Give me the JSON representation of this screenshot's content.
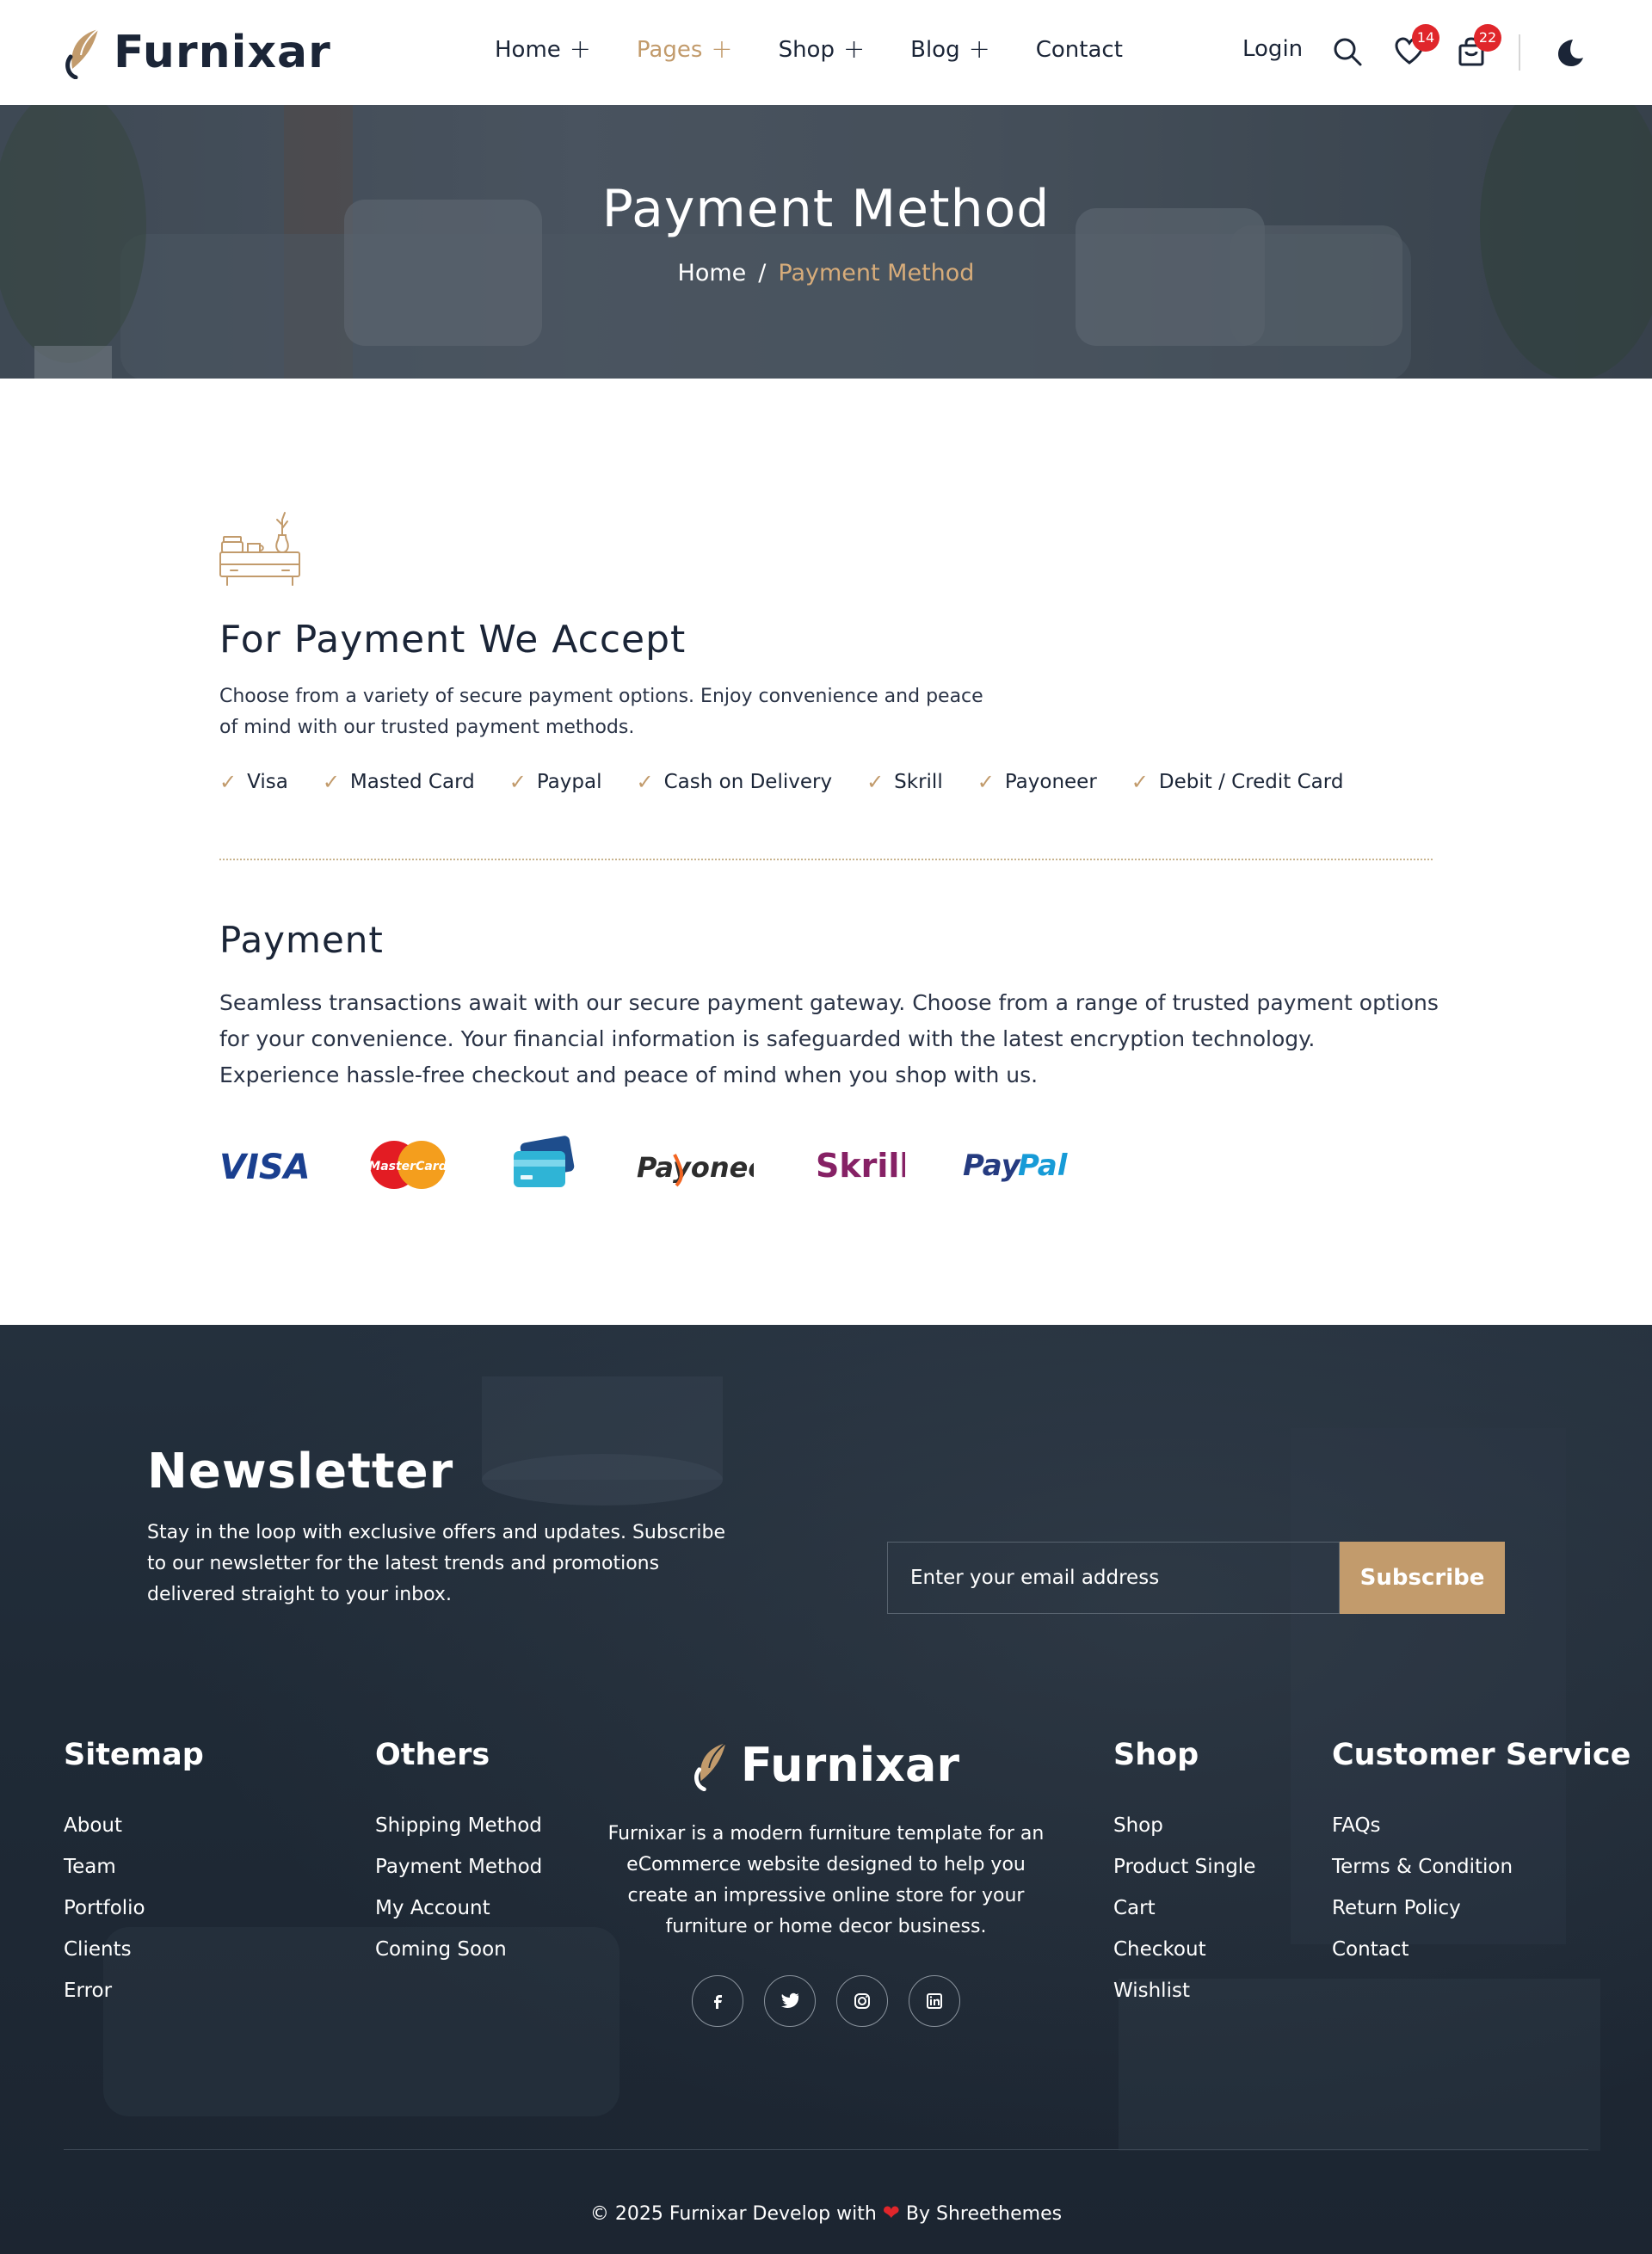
{
  "brand": {
    "name": "Furnixar",
    "accent": "#c29b6c",
    "dark": "#1b2537",
    "badge_color": "#e0262b"
  },
  "nav": {
    "items": [
      {
        "label": "Home",
        "has_submenu": true
      },
      {
        "label": "Pages",
        "has_submenu": true,
        "active": true
      },
      {
        "label": "Shop",
        "has_submenu": true
      },
      {
        "label": "Blog",
        "has_submenu": true
      },
      {
        "label": "Contact",
        "has_submenu": false
      }
    ],
    "login_label": "Login",
    "wishlist_count": "14",
    "cart_count": "22"
  },
  "hero": {
    "title": "Payment Method",
    "breadcrumb": {
      "home": "Home",
      "separator": "/",
      "current": "Payment Method"
    }
  },
  "accept": {
    "heading": "For Payment We Accept",
    "description": "Choose from a variety of secure payment options. Enjoy convenience and peace of mind with our trusted payment methods.",
    "methods": [
      "Visa",
      "Masted Card",
      "Paypal",
      "Cash on Delivery",
      "Skrill",
      "Payoneer",
      "Debit / Credit Card"
    ]
  },
  "payment": {
    "heading": "Payment",
    "description": "Seamless transactions await with our secure payment gateway. Choose from a range of trusted payment options for your convenience. Your financial information is safeguarded with the latest encryption technology. Experience hassle-free checkout and peace of mind when you shop with us.",
    "logos": {
      "visa": "VISA",
      "mastercard": "MasterCard",
      "payoneer": "Payoneer",
      "skrill": "Skrill",
      "paypal_1": "Pay",
      "paypal_2": "Pal"
    }
  },
  "newsletter": {
    "title": "Newsletter",
    "text": "Stay in the loop with exclusive offers and updates. Subscribe to our newsletter for the latest trends and promotions delivered straight to your inbox.",
    "placeholder": "Enter your email address",
    "button": "Subscribe"
  },
  "footer": {
    "sitemap": {
      "title": "Sitemap",
      "links": [
        "About",
        "Team",
        "Portfolio",
        "Clients",
        "Error"
      ]
    },
    "others": {
      "title": "Others",
      "links": [
        "Shipping Method",
        "Payment Method",
        "My Account",
        "Coming Soon"
      ]
    },
    "about": "Furnixar is a modern furniture template for an eCommerce website designed to help you create an impressive online store for your furniture or home decor business.",
    "socials": [
      "facebook-icon",
      "twitter-icon",
      "instagram-icon",
      "linkedin-icon"
    ],
    "shop": {
      "title": "Shop",
      "links": [
        "Shop",
        "Product Single",
        "Cart",
        "Checkout",
        "Wishlist"
      ]
    },
    "service": {
      "title": "Customer Service",
      "links": [
        "FAQs",
        "Terms & Condition",
        "Return Policy",
        "Contact"
      ]
    },
    "copyright_left": "© 2025 Furnixar Develop with",
    "copyright_right": "By Shreethemes"
  }
}
